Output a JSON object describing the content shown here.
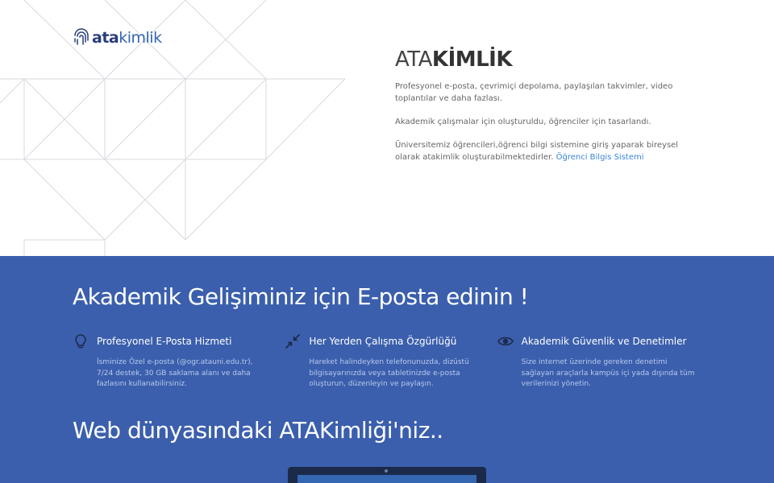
{
  "header": {
    "logo_part1": "ata",
    "logo_part2": "kimlik",
    "logo_icon": "fingerprint-icon"
  },
  "intro": {
    "brand_light": "ATA",
    "brand_bold": "KİMLİK",
    "p1": "Profesyonel e-posta, çevrimiçi depolama, paylaşılan takvimler, video toplantılar ve daha fazlası.",
    "p2": "Akademik çalışmalar için oluşturuldu, öğrenciler için tasarlandı.",
    "p3": "Üniversitemiz öğrencileri,öğrenci bilgi sistemine giriş yaparak bireysel olarak atakimlik oluşturabilmektedirler.",
    "link": "Öğrenci Bilgis Sistemi"
  },
  "band": {
    "heading": "Akademik Gelişiminiz için E-posta edinin !",
    "features": [
      {
        "icon": "lightbulb-icon",
        "title": "Profesyonel E-Posta Hizmeti",
        "desc": "İsminize Özel e-posta (@ogr.atauni.edu.tr), 7/24 destek, 30 GB saklama alanı ve daha fazlasını kullanabilirsiniz."
      },
      {
        "icon": "compress-arrows-icon",
        "title": "Her Yerden Çalışma Özgürlüğü",
        "desc": "Hareket halindeyken telefonunuzda, dizüstü bilgisayarınızda veya tabletinizde e-posta oluşturun, düzenleyin ve paylaşın."
      },
      {
        "icon": "eye-icon",
        "title": "Akademik Güvenlik ve Denetimler",
        "desc": "Size internet üzerinde gereken denetimi sağlayan araçlarla kampüs içi yada dışında tüm verilerinizi yönetin."
      }
    ],
    "subheading": "Web dünyasındaki ATAKimliği'niz.."
  },
  "colors": {
    "band": "#3b5fad",
    "link": "#3b84d8",
    "logo_dark": "#2a3d7a",
    "logo_light": "#3566b2"
  }
}
